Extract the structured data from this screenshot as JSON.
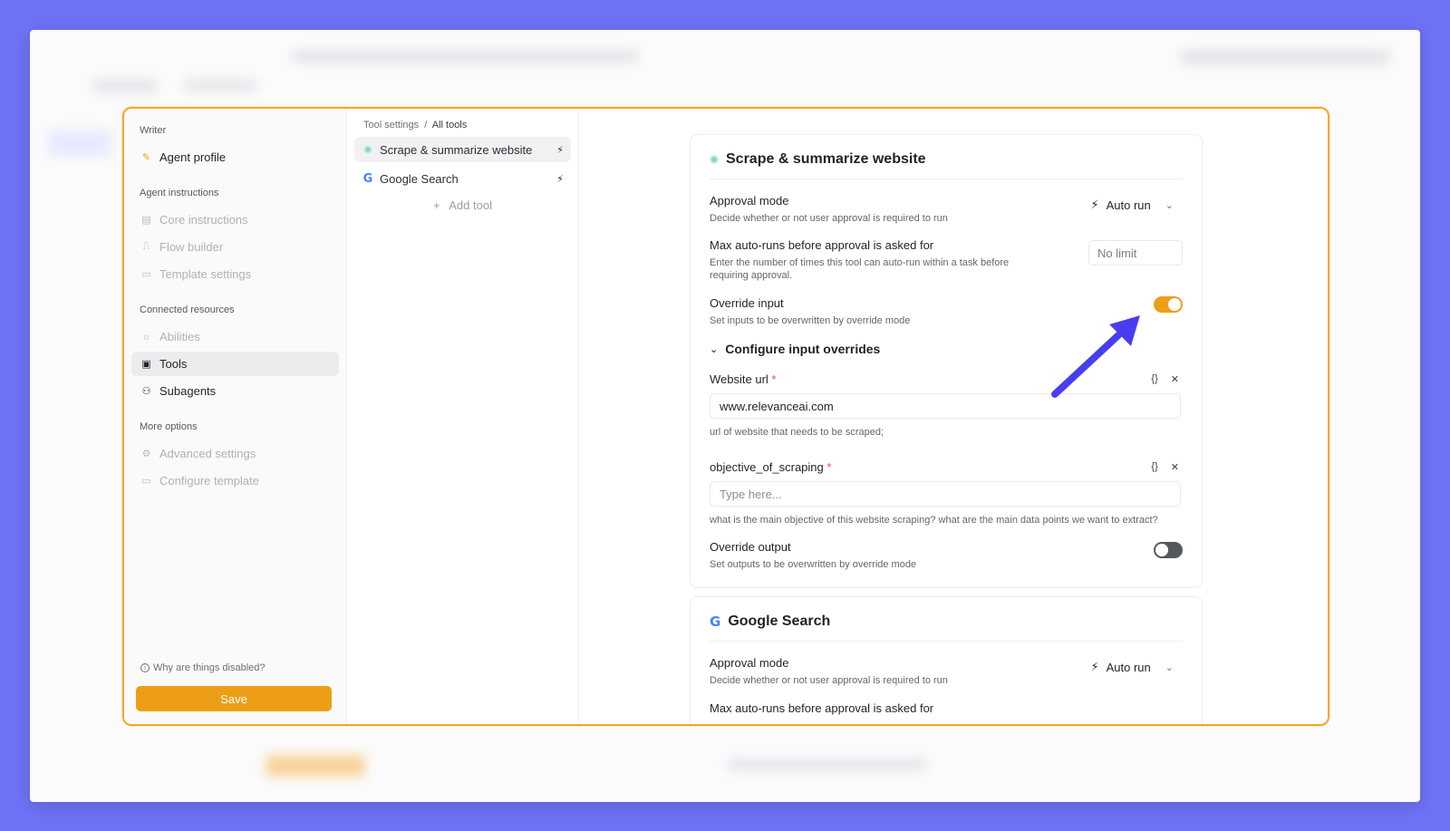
{
  "left": {
    "writer_label": "Writer",
    "agent_profile": "Agent profile",
    "instructions_group": "Agent instructions",
    "instructions_items": [
      "Core instructions",
      "Flow builder",
      "Template settings"
    ],
    "resources_group": "Connected resources",
    "resources_items": [
      "Abilities",
      "Tools",
      "Subagents"
    ],
    "more_group": "More options",
    "more_items": [
      "Advanced settings",
      "Configure template"
    ],
    "why_disabled": "Why are things disabled?",
    "save_label": "Save"
  },
  "middle": {
    "breadcrumb_root": "Tool settings",
    "breadcrumb_sep": "/",
    "breadcrumb_current": "All tools",
    "tools": [
      "Scrape & summarize website",
      "Google Search"
    ],
    "add_tool": "Add tool"
  },
  "scrape_card": {
    "title": "Scrape & summarize website",
    "approval_label": "Approval mode",
    "approval_desc": "Decide whether or not user approval is required to run",
    "approval_value": "Auto run",
    "max_label": "Max auto-runs before approval is asked for",
    "max_desc": "Enter the number of times this tool can auto-run within a task before requiring approval.",
    "max_placeholder": "No limit",
    "override_input_label": "Override input",
    "override_input_desc": "Set inputs to be overwritten by override mode",
    "override_input_on": true,
    "configure_label": "Configure input overrides",
    "website_label": "Website url",
    "website_value": "www.relevanceai.com",
    "website_desc": "url of website that needs to be scraped;",
    "objective_label": "objective_of_scraping",
    "objective_placeholder": "Type here...",
    "objective_desc": "what is the main objective of this website scraping? what are the main data points we want to extract?",
    "override_output_label": "Override output",
    "override_output_desc": "Set outputs to be overwritten by override mode",
    "override_output_on": false
  },
  "google_card": {
    "title": "Google Search",
    "approval_label": "Approval mode",
    "approval_desc": "Decide whether or not user approval is required to run",
    "approval_value": "Auto run",
    "max_label": "Max auto-runs before approval is asked for"
  },
  "colors": {
    "background": "#6e72f5",
    "accent": "#ec9f16",
    "highlight_border": "#f2a92b",
    "arrow": "#4a3df0"
  }
}
